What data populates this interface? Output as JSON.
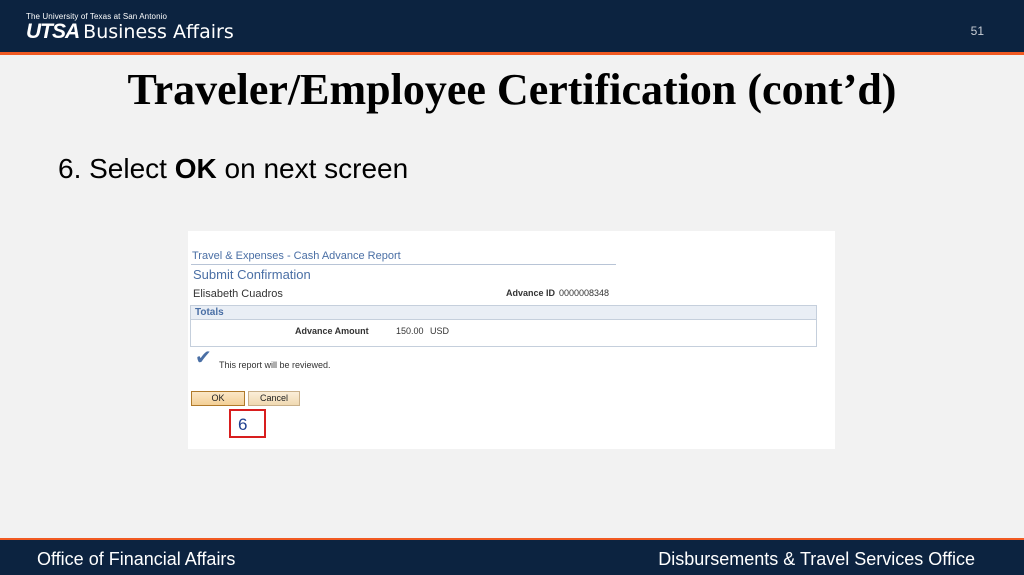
{
  "header": {
    "university": "The University of Texas at San Antonio",
    "logo_short": "UTSA",
    "logo_dept": "Business Affairs",
    "slide_number": "51"
  },
  "slide": {
    "title": "Traveler/Employee Certification (cont’d)",
    "step_prefix": "6. Select ",
    "step_bold": "OK",
    "step_suffix": " on next screen"
  },
  "screenshot": {
    "header": "Travel & Expenses - Cash Advance Report",
    "page_title": "Submit Confirmation",
    "employee_name": "Elisabeth Cuadros",
    "advance_id_label": "Advance ID",
    "advance_id_value": "0000008348",
    "totals_label": "Totals",
    "advance_amount_label": "Advance Amount",
    "advance_amount_value": "150.00",
    "currency": "USD",
    "review_message": "This report will be reviewed.",
    "ok_label": "OK",
    "cancel_label": "Cancel",
    "callout_number": "6"
  },
  "footer": {
    "left": "Office of Financial Affairs",
    "right": "Disbursements & Travel Services Office"
  },
  "colors": {
    "navy": "#0c2340",
    "orange": "#f15a22",
    "link_blue": "#4a6fa5",
    "callout_red": "#d81e1e"
  }
}
